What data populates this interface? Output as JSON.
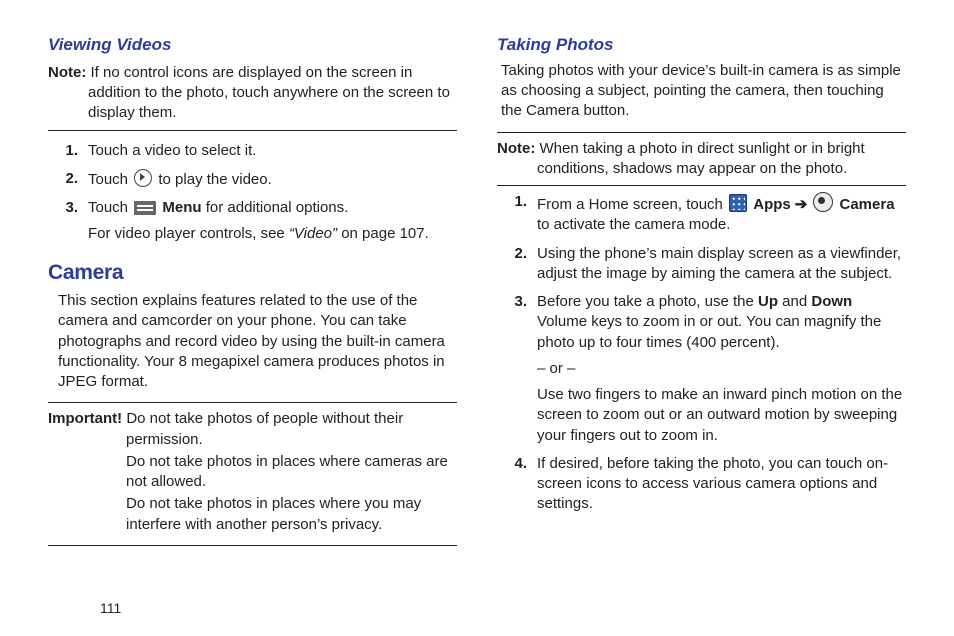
{
  "page_number": "111",
  "left": {
    "heading_viewing": "Viewing Videos",
    "note_label": "Note:",
    "note_text": "If no control icons are displayed on the screen in addition to the photo, touch anywhere on the screen to display them.",
    "steps": [
      {
        "num": "1.",
        "text": "Touch a video to select it."
      },
      {
        "num": "2.",
        "pre": "Touch ",
        "post": " to play the video."
      },
      {
        "num": "3.",
        "pre": "Touch ",
        "menu_word": "Menu",
        "post": " for additional options.",
        "sub_pre": "For video player controls, see ",
        "sub_italic": "“Video”",
        "sub_post": " on page 107."
      }
    ],
    "heading_camera": "Camera",
    "camera_intro": "This section explains features related to the use of the camera and camcorder on your phone. You can take photographs and record video by using the built-in camera functionality. Your 8 megapixel camera produces photos in JPEG format.",
    "important_label": "Important!",
    "important_lines": [
      "Do not take photos of people without their permission.",
      "Do not take photos in places where cameras are not allowed.",
      "Do not take photos in places where you may interfere with another person’s privacy."
    ]
  },
  "right": {
    "heading_taking": "Taking Photos",
    "intro": "Taking photos with your device’s built-in camera is as simple as choosing a subject, pointing the camera, then touching the Camera button.",
    "note_label": "Note:",
    "note_text": "When taking a photo in direct sunlight or in bright conditions, shadows may appear on the photo.",
    "steps": [
      {
        "num": "1.",
        "pre": "From a Home screen, touch ",
        "apps_word": "Apps",
        "arrow": "➔",
        "camera_word": "Camera",
        "post": " to activate the camera mode."
      },
      {
        "num": "2.",
        "text": "Using the phone’s main display screen as a viewfinder, adjust the image by aiming the camera at the subject."
      },
      {
        "num": "3.",
        "pre": "Before you take a photo, use the ",
        "up": "Up",
        "mid": " and ",
        "down": "Down",
        "post": " Volume keys to zoom in or out. You can magnify the photo up to four times (400 percent).",
        "or": "– or –",
        "or_text": "Use two fingers to make an inward pinch motion on the screen to zoom out or an outward motion by sweeping your fingers out to zoom in."
      },
      {
        "num": "4.",
        "text": "If desired, before taking the photo, you can touch on-screen icons to access various camera options and settings."
      }
    ]
  }
}
